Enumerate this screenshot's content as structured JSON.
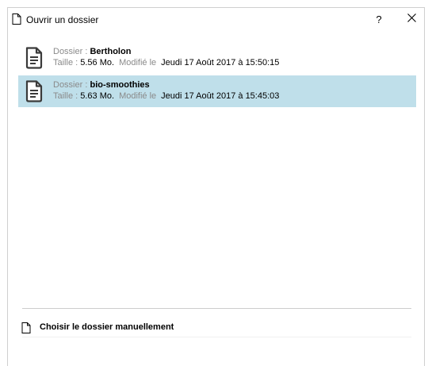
{
  "window": {
    "title": "Ouvrir un dossier",
    "help_label": "?"
  },
  "folders": [
    {
      "dossier_label": "Dossier : ",
      "name": "Bertholon",
      "taille_label": "Taille : ",
      "size": "5.56 Mo.",
      "modifie_label": "Modifié le",
      "date": "Jeudi 17 Août 2017 à 15:50:15",
      "selected": false
    },
    {
      "dossier_label": "Dossier : ",
      "name": "bio-smoothies",
      "taille_label": "Taille : ",
      "size": "5.63 Mo.",
      "modifie_label": "Modifié le",
      "date": "Jeudi 17 Août 2017 à 15:45:03",
      "selected": true
    }
  ],
  "manual": {
    "label": "Choisir le dossier manuellement"
  },
  "colors": {
    "selection": "#bfdfea",
    "muted_label": "#8a8a8a"
  }
}
